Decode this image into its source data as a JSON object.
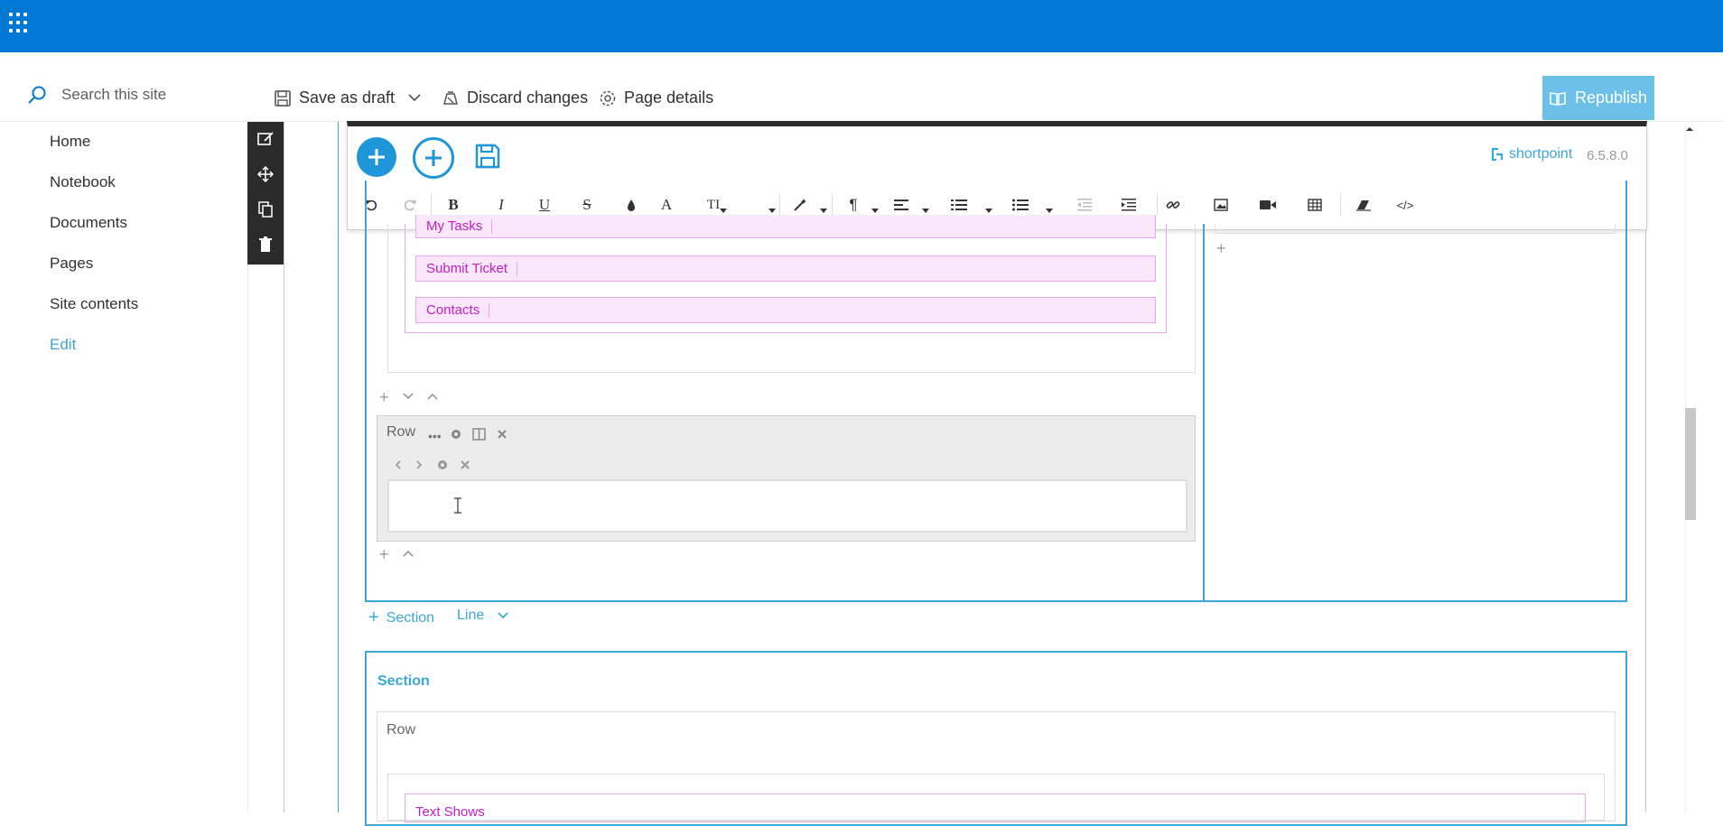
{
  "header": {
    "waffle_icon": "waffle-icon",
    "brand_color": "#0078d4"
  },
  "search": {
    "placeholder": "Search this site"
  },
  "commands": {
    "save_as_draft": "Save as draft",
    "discard_changes": "Discard changes",
    "page_details": "Page details",
    "republish": "Republish"
  },
  "nav": {
    "items": [
      "Home",
      "Notebook",
      "Documents",
      "Pages",
      "Site contents",
      "Edit"
    ]
  },
  "editor": {
    "brand": "shortpoint",
    "version": "6.5.8.0"
  },
  "content": {
    "links": [
      "My Tasks",
      "Submit Ticket",
      "Contacts"
    ],
    "row_label": "Row",
    "section_add": "Section",
    "line_add": "Line",
    "section_title": "Section",
    "row_label_2": "Row",
    "text_shows": "Text Shows"
  }
}
